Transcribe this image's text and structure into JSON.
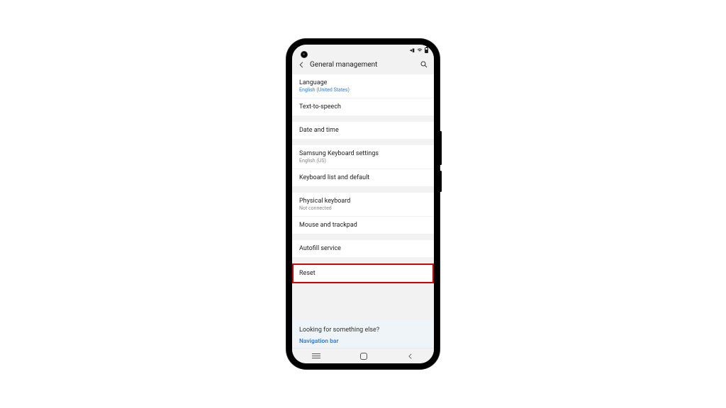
{
  "header": {
    "title": "General management"
  },
  "items": {
    "language": {
      "label": "Language",
      "value": "English (United States)"
    },
    "tts": {
      "label": "Text-to-speech"
    },
    "datetime": {
      "label": "Date and time"
    },
    "keyboard": {
      "label": "Samsung Keyboard settings",
      "value": "English (US)"
    },
    "keyboard_list": {
      "label": "Keyboard list and default"
    },
    "physical_keyboard": {
      "label": "Physical keyboard",
      "value": "Not connected"
    },
    "mouse": {
      "label": "Mouse and trackpad"
    },
    "autofill": {
      "label": "Autofill service"
    },
    "reset": {
      "label": "Reset"
    }
  },
  "footer": {
    "question": "Looking for something else?",
    "link": "Navigation bar"
  },
  "status_icons": [
    "sound",
    "wifi",
    "battery"
  ]
}
